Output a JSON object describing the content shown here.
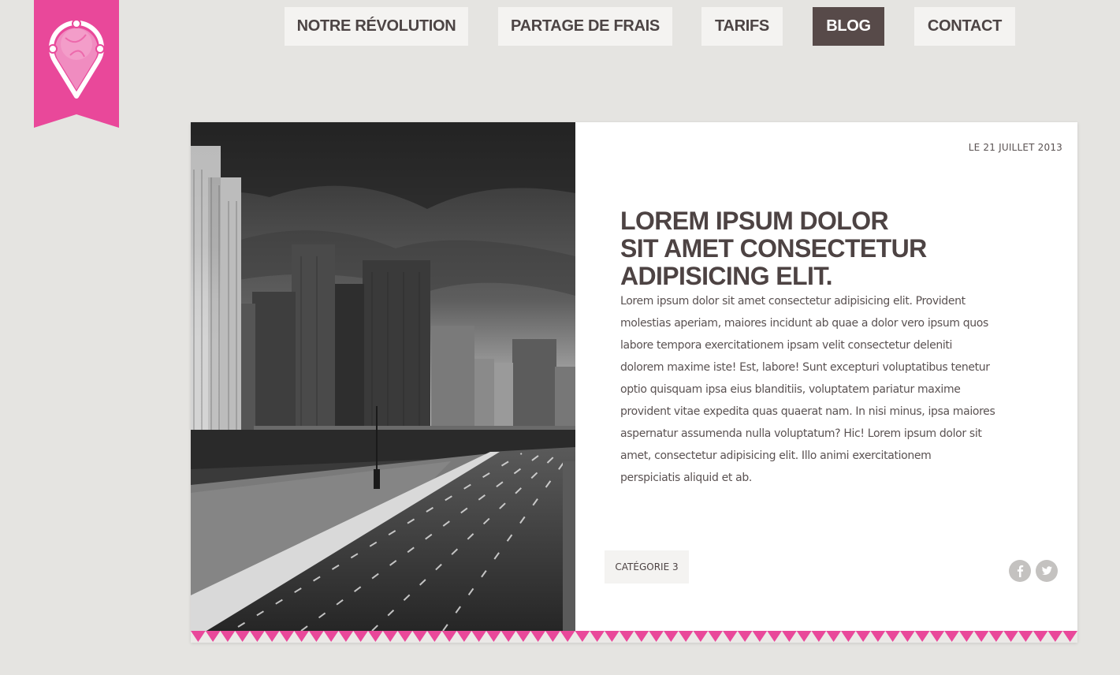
{
  "colors": {
    "brand_pink": "#e9489a",
    "nav_bg": "#f4f3f1",
    "nav_active_bg": "#574a49",
    "text_dark": "#4d4343",
    "page_bg": "#e5e4e1"
  },
  "logo": {
    "icon": "map-pin-logo-icon"
  },
  "nav": {
    "items": [
      {
        "label": "NOTRE RÉVOLUTION",
        "active": false
      },
      {
        "label": "PARTAGE DE FRAIS",
        "active": false
      },
      {
        "label": "TARIFS",
        "active": false
      },
      {
        "label": "BLOG",
        "active": true
      },
      {
        "label": "CONTACT",
        "active": false
      }
    ]
  },
  "post": {
    "date": "LE 21 JUILLET 2013",
    "title_lines": [
      "LOREM IPSUM DOLOR",
      "SIT AMET CONSECTETUR",
      "ADIPISICING ELIT."
    ],
    "body_lines": [
      "Lorem ipsum dolor sit amet consectetur adipisicing elit. Provident",
      "molestias aperiam, maiores incidunt ab quae a dolor vero ipsum quos",
      "labore tempora exercitationem ipsam velit consectetur deleniti",
      "dolorem maxime iste! Est, labore! Sunt excepturi voluptatibus tenetur",
      "optio quisquam ipsa eius blanditiis, voluptatem pariatur maxime",
      "provident vitae expedita quas quaerat nam. In nisi minus, ipsa maiores",
      "aspernatur assumenda nulla voluptatum? Hic! Lorem ipsum dolor sit",
      "amet, consectetur adipisicing elit. Illo animi exercitationem",
      "perspiciatis aliquid et ab."
    ],
    "category": "CATÉGORIE 3",
    "image": "city-highway-photo",
    "social": [
      {
        "icon": "facebook-icon"
      },
      {
        "icon": "twitter-icon"
      }
    ]
  }
}
